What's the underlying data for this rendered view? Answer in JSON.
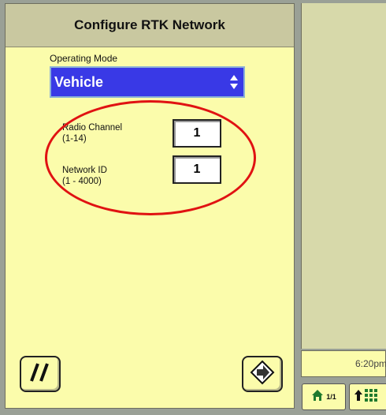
{
  "dialog": {
    "title": "Configure RTK Network",
    "operating_mode_label": "Operating Mode",
    "operating_mode_value": "Vehicle",
    "radio_channel_label_line1": "Radio Channel",
    "radio_channel_label_line2": "(1-14)",
    "radio_channel_value": "1",
    "network_id_label_line1": "Network ID",
    "network_id_label_line2": "(1 - 4000)",
    "network_id_value": "1",
    "annotation_color": "#e01212"
  },
  "status": {
    "time": "6:20pm"
  },
  "nav": {
    "page_indicator": "1/1"
  },
  "icons": {
    "cancel": "slash-icon",
    "next": "arrow-right-icon",
    "home": "home-icon",
    "menu": "up-arrow-menu-icon"
  },
  "colors": {
    "panel_bg": "#fbfcab",
    "header_bg": "#c9c8a0",
    "select_bg": "#3939e6",
    "right_area_bg": "#d7d9aa"
  }
}
